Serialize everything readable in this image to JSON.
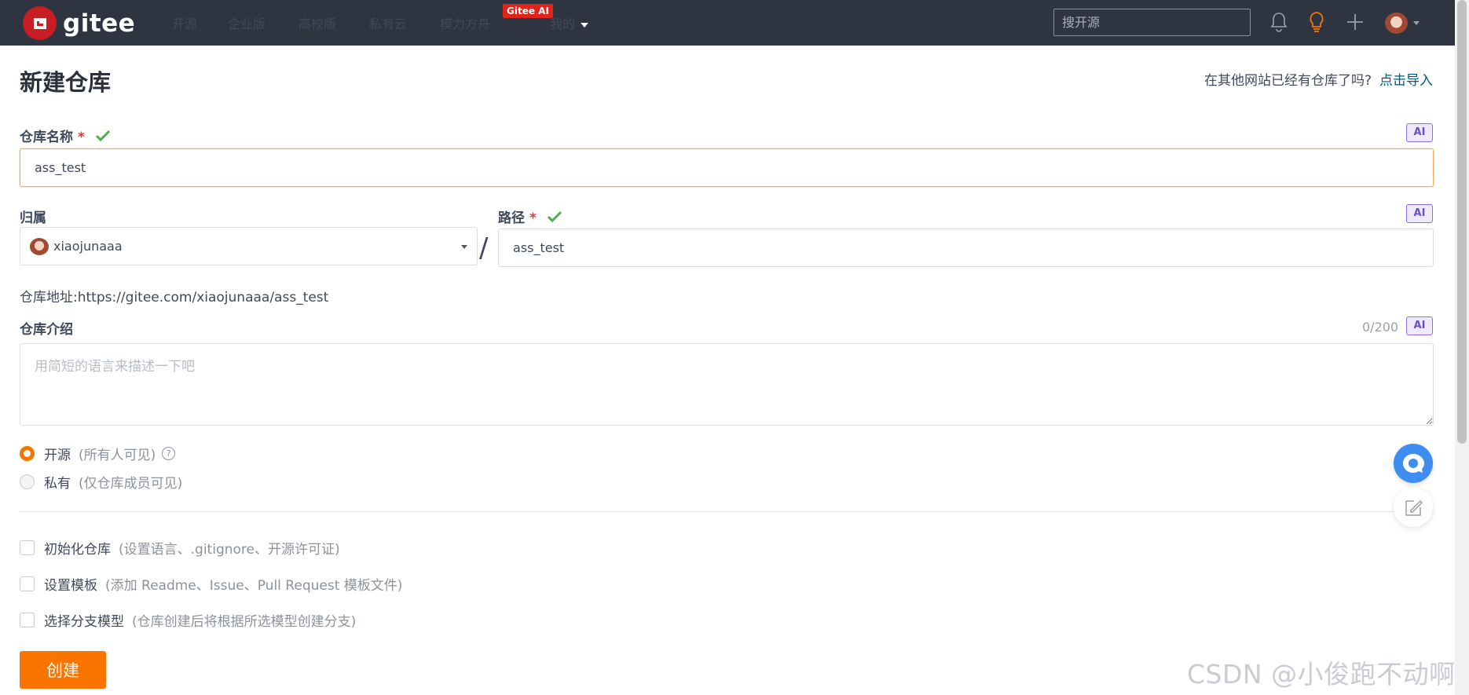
{
  "header": {
    "logo_text": "gitee",
    "nav": [
      {
        "label": "开源"
      },
      {
        "label": "企业版"
      },
      {
        "label": "高校版"
      },
      {
        "label": "私有云"
      },
      {
        "label": "模力方舟"
      },
      {
        "label": "我的"
      }
    ],
    "ai_badge": "Gitee AI",
    "search_placeholder": "搜开源"
  },
  "page": {
    "title": "新建仓库",
    "import_hint": "在其他网站已经有仓库了吗?",
    "import_link": "点击导入"
  },
  "form": {
    "ai_label": "AI",
    "required_mark": "*",
    "repo_name": {
      "label": "仓库名称",
      "value": "ass_test"
    },
    "owner": {
      "label": "归属",
      "value": "xiaojunaaa"
    },
    "path_separator": "/",
    "path": {
      "label": "路径",
      "value": "ass_test"
    },
    "repo_url": "仓库地址:https://gitee.com/xiaojunaaa/ass_test",
    "description": {
      "label": "仓库介绍",
      "counter": "0/200",
      "placeholder": "用简短的语言来描述一下吧"
    },
    "visibility": [
      {
        "label": "开源",
        "hint": "(所有人可见)",
        "selected": true
      },
      {
        "label": "私有",
        "hint": "(仅仓库成员可见)",
        "selected": false
      }
    ],
    "options": [
      {
        "label": "初始化仓库",
        "hint": "(设置语言、.gitignore、开源许可证)",
        "checked": false
      },
      {
        "label": "设置模板",
        "hint": "(添加 Readme、Issue、Pull Request 模板文件)",
        "checked": false
      },
      {
        "label": "选择分支模型",
        "hint": "(仓库创建后将根据所选模型创建分支)",
        "checked": false
      }
    ],
    "submit_label": "创建"
  },
  "watermark": "CSDN @小俊跑不动啊",
  "colors": {
    "brand": "#c71d23",
    "accent": "#fa7500",
    "header_bg": "#2f3441",
    "success": "#4caf50",
    "link": "#005980"
  }
}
